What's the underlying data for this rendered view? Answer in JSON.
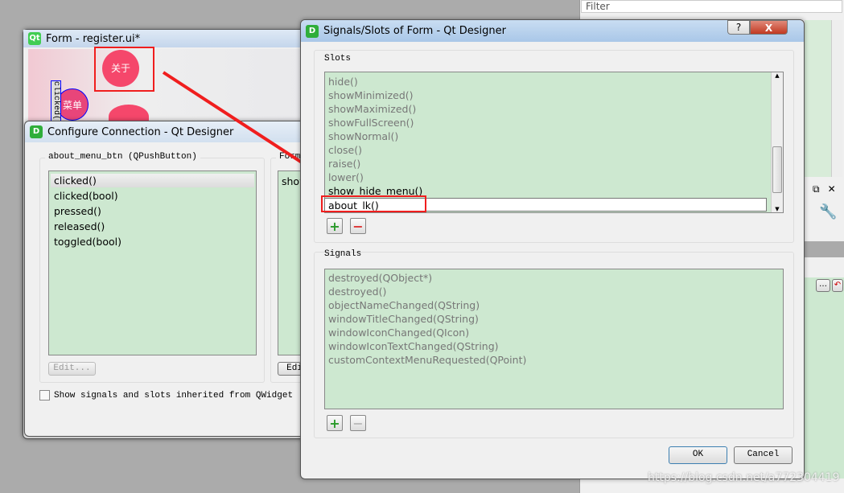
{
  "right_panel": {
    "filter_placeholder": "Filter"
  },
  "form_window": {
    "title": "Form - register.ui*",
    "app_icon": "Qt",
    "about_button": "关于",
    "menu_button": "菜单",
    "clicked_tag": "clicked()"
  },
  "configure_dialog": {
    "title": "Configure Connection - Qt Designer",
    "left_group": "about_menu_btn (QPushButton)",
    "signals": [
      "clicked()",
      "clicked(bool)",
      "pressed()",
      "released()",
      "toggled(bool)"
    ],
    "right_group": "Form",
    "slots_partial": "show",
    "edit_label": "Edit...",
    "edit_label_right": "Edi",
    "inherit_checkbox": "Show signals and slots inherited from QWidget",
    "inherit_checked": false
  },
  "slots_dialog": {
    "title": "Signals/Slots of Form - Qt Designer",
    "slots_label": "Slots",
    "slots": [
      "hide()",
      "showMinimized()",
      "showMaximized()",
      "showFullScreen()",
      "showNormal()",
      "close()",
      "raise()",
      "lower()",
      "show_hide_menu()"
    ],
    "editing_slot": "about_lk()",
    "signals_label": "Signals",
    "signals": [
      "destroyed(QObject*)",
      "destroyed()",
      "objectNameChanged(QString)",
      "windowTitleChanged(QString)",
      "windowIconChanged(QIcon)",
      "windowIconTextChanged(QString)",
      "customContextMenuRequested(QPoint)"
    ],
    "ok": "OK",
    "cancel": "Cancel",
    "help": "?",
    "close": "X"
  },
  "watermark": "https://blog.csdn.net/a772304419",
  "colors": {
    "list_bg": "#cde8d0",
    "highlight": "#f01e1e",
    "button_pink": "#f5476b"
  }
}
